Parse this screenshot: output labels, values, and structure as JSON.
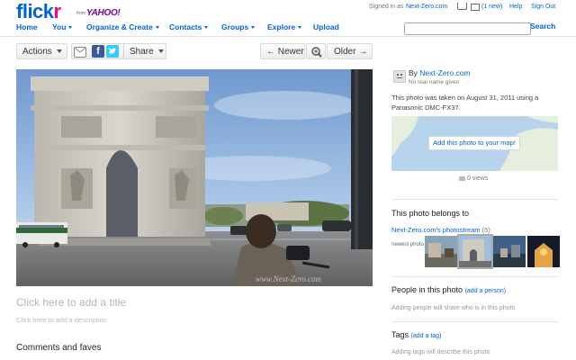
{
  "brand": {
    "logo_part1": "flick",
    "logo_part2": "r",
    "from": "from",
    "yahoo": "YAHOO!"
  },
  "nav": [
    {
      "label": "Home",
      "dropdown": false
    },
    {
      "label": "You",
      "dropdown": true
    },
    {
      "label": "Organize & Create",
      "dropdown": true
    },
    {
      "label": "Contacts",
      "dropdown": true
    },
    {
      "label": "Groups",
      "dropdown": true
    },
    {
      "label": "Explore",
      "dropdown": true
    },
    {
      "label": "Upload",
      "dropdown": false
    }
  ],
  "userbar": {
    "signed_in_prefix": "Signed in as",
    "username": "Next-Zero.com",
    "mail_count": "(1 new)",
    "help": "Help",
    "sign_out": "Sign Out"
  },
  "search": {
    "placeholder": "",
    "button": "Search"
  },
  "toolbar": {
    "actions": "Actions",
    "share": "Share",
    "newer": "← Newer",
    "older": "Older →",
    "icons": [
      "email-icon",
      "facebook-icon",
      "twitter-icon",
      "zoom-icon"
    ]
  },
  "photo": {
    "watermark": "www.Next-Zero.com",
    "title_placeholder": "Click here to add a title",
    "description_placeholder": "Click here to add a description"
  },
  "comments_heading": "Comments and faves",
  "owner": {
    "by": "By",
    "name": "Next-Zero.com",
    "real_name": "No real name given",
    "taken_text": "This photo was taken on August 31, 2011 using a Panasonic DMC-FX37."
  },
  "map": {
    "add_button": "Add this photo to your map!"
  },
  "views": "0 views",
  "belongs": {
    "heading": "This photo belongs to",
    "stream_name": "Next-Zero.com's photostream",
    "stream_count": "(5)",
    "newest_label": "newest photo"
  },
  "people": {
    "heading": "People in this photo",
    "add_link": "(add a person)",
    "hint": "Adding people will share who is in this photo"
  },
  "tags": {
    "heading": "Tags",
    "add_link": "(add a tag)",
    "hint": "Adding tags will describe this photo"
  },
  "colors": {
    "link": "#0063dc",
    "flickr_pink": "#ff0084",
    "yahoo_purple": "#7b0099"
  }
}
